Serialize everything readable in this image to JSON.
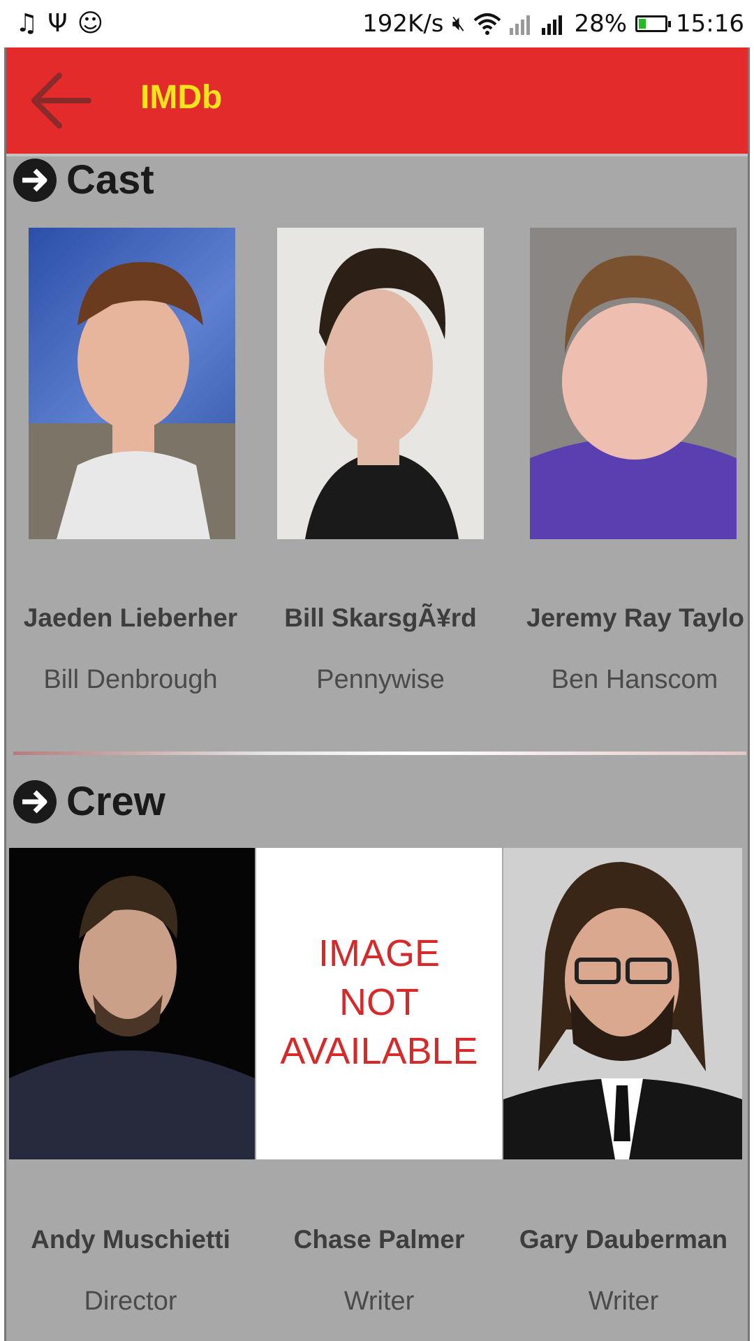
{
  "status_bar": {
    "speed": "192K/s",
    "battery": "28%",
    "battery_level": 0.28,
    "time": "15:16",
    "icons": [
      "music-note-icon",
      "usb-icon",
      "smiley-icon",
      "mute-icon",
      "wifi-icon",
      "signal-icon",
      "signal-icon"
    ]
  },
  "app_bar": {
    "title": "IMDb",
    "back_icon": "back-arrow-icon"
  },
  "cast": {
    "title": "Cast",
    "members": [
      {
        "name": "Jaeden Lieberher",
        "role": "Bill Denbrough"
      },
      {
        "name": "Bill SkarsgÃ¥rd",
        "role": "Pennywise"
      },
      {
        "name": "Jeremy Ray Taylo",
        "role": "Ben Hanscom"
      }
    ]
  },
  "crew": {
    "title": "Crew",
    "members": [
      {
        "name": "Andy Muschietti",
        "role": "Director"
      },
      {
        "name": "Chase Palmer",
        "role": "Writer",
        "placeholder": [
          "IMAGE",
          "NOT",
          "AVAILABLE"
        ]
      },
      {
        "name": "Gary Dauberman",
        "role": "Writer"
      }
    ]
  },
  "colors": {
    "app_bar": "#e32b2b",
    "title": "#f5e31b",
    "background": "#a8a8a8"
  }
}
